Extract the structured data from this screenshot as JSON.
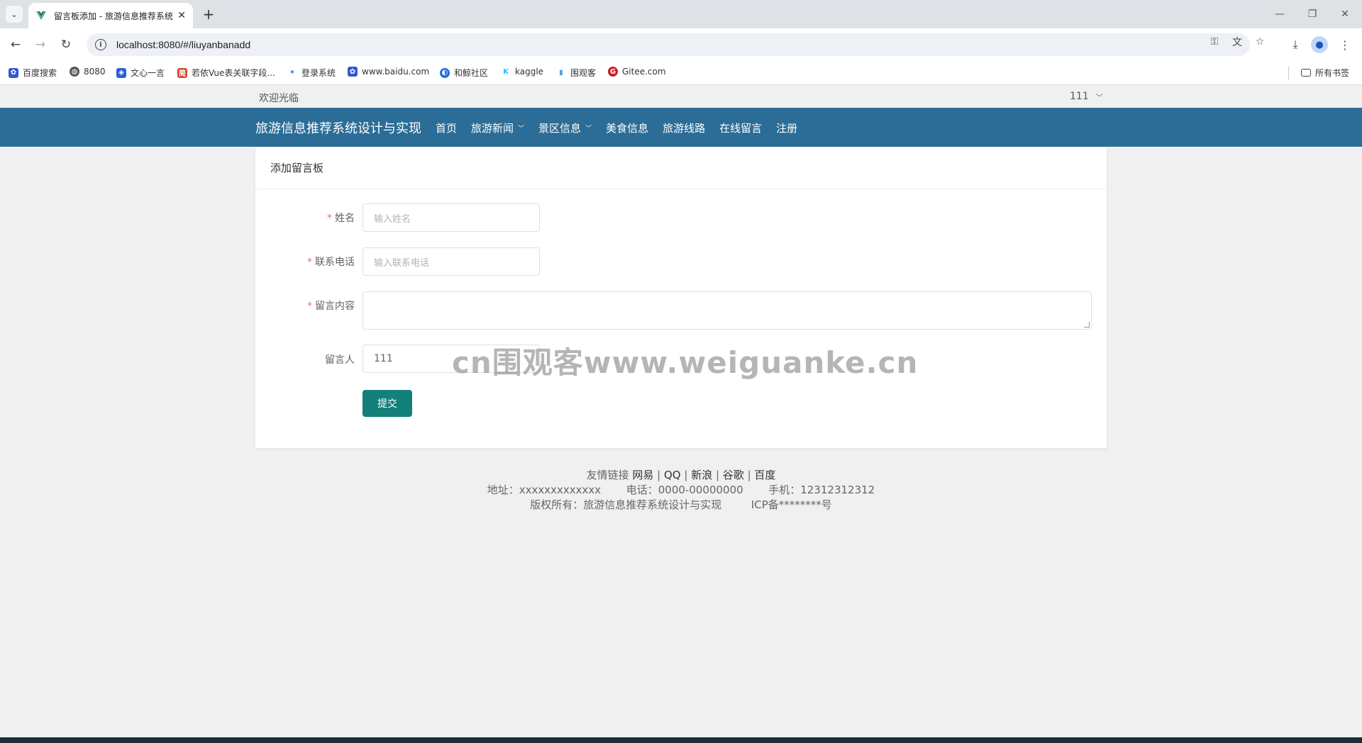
{
  "browser": {
    "tab_title": "留言板添加 - 旅游信息推荐系统",
    "tab_close": "✕",
    "new_tab": "+",
    "url": "localhost:8080/#/liuyanbanadd",
    "bookmarks": [
      "百度搜索",
      "8080",
      "文心一言",
      "若依Vue表关联字段...",
      "登录系统",
      "www.baidu.com",
      "和鲸社区",
      "kaggle",
      "围观客",
      "Gitee.com"
    ],
    "all_bookmarks": "所有书签"
  },
  "site": {
    "welcome": "欢迎光临",
    "user": "111",
    "brand": "旅游信息推荐系统设计与实现",
    "nav": [
      "首页",
      "旅游新闻",
      "景区信息",
      "美食信息",
      "旅游线路",
      "在线留言",
      "注册"
    ]
  },
  "form": {
    "title": "添加留言板",
    "name_label": "姓名",
    "name_placeholder": "输入姓名",
    "phone_label": "联系电话",
    "phone_placeholder": "输入联系电话",
    "content_label": "留言内容",
    "content_value": "",
    "author_label": "留言人",
    "author_value": "111",
    "submit": "提交"
  },
  "watermark": "cn围观客www.weiguanke.cn",
  "footer": {
    "links_label": "友情链接",
    "links": [
      "网易",
      "QQ",
      "新浪",
      "谷歌",
      "百度"
    ],
    "address": "地址：xxxxxxxxxxxxx",
    "phone": "电话：0000-00000000",
    "mobile": "手机：12312312312",
    "copyright": "版权所有：旅游信息推荐系统设计与实现",
    "icp": "ICP备********号"
  }
}
